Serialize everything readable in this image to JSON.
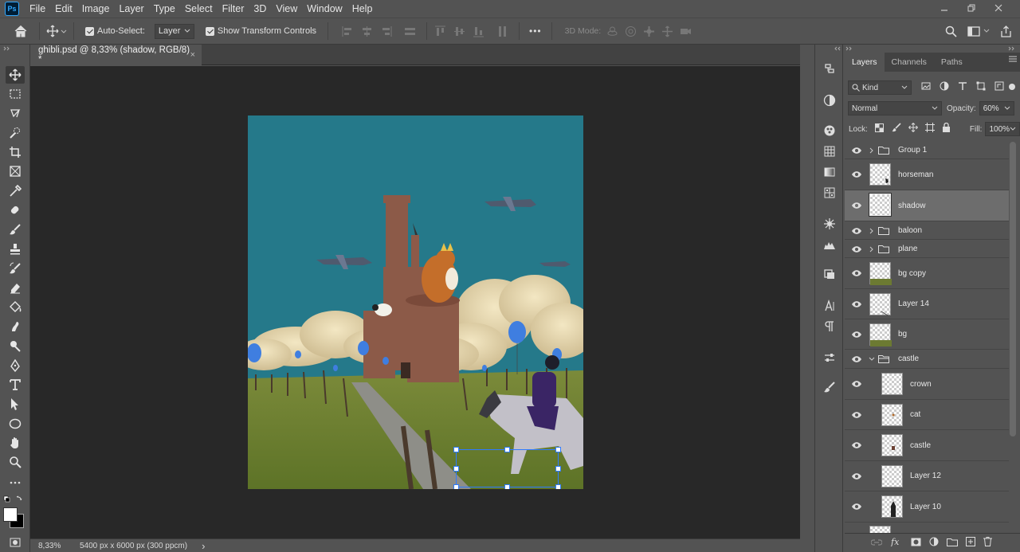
{
  "app": {
    "logo": "Ps"
  },
  "menu": [
    "File",
    "Edit",
    "Image",
    "Layer",
    "Type",
    "Select",
    "Filter",
    "3D",
    "View",
    "Window",
    "Help"
  ],
  "options_bar": {
    "auto_select_label": "Auto-Select:",
    "auto_select_checked": true,
    "auto_select_target": "Layer",
    "transform_controls_label": "Show Transform Controls",
    "transform_controls_checked": true,
    "more_label": "•••",
    "mode_3d_label": "3D Mode:"
  },
  "document_tab": {
    "title": "ghibli.psd @ 8,33% (shadow, RGB/8) *",
    "close": "×"
  },
  "status": {
    "zoom": "8,33%",
    "doc_info": "5400 px x 6000 px (300 ppcm)",
    "arrow": "›"
  },
  "panel": {
    "tabs": [
      "Layers",
      "Channels",
      "Paths"
    ],
    "active_tab": "Layers",
    "filter_kind": "Kind",
    "blend_mode": "Normal",
    "opacity_label": "Opacity:",
    "opacity_value": "60%",
    "lock_label": "Lock:",
    "fill_label": "Fill:",
    "fill_value": "100%"
  },
  "layers": [
    {
      "name": "Group 1",
      "type": "group",
      "expanded": false,
      "indent": 0,
      "selected": false
    },
    {
      "name": "horseman",
      "type": "layer",
      "indent": 0,
      "selected": false
    },
    {
      "name": "shadow",
      "type": "layer",
      "indent": 0,
      "selected": true
    },
    {
      "name": "baloon",
      "type": "group",
      "expanded": false,
      "indent": 0,
      "selected": false
    },
    {
      "name": "plane",
      "type": "group",
      "expanded": false,
      "indent": 0,
      "selected": false
    },
    {
      "name": "bg copy",
      "type": "layer",
      "indent": 0,
      "selected": false
    },
    {
      "name": "Layer 14",
      "type": "layer",
      "indent": 0,
      "selected": false
    },
    {
      "name": "bg",
      "type": "layer",
      "indent": 0,
      "selected": false
    },
    {
      "name": "castle",
      "type": "group",
      "expanded": true,
      "indent": 0,
      "selected": false
    },
    {
      "name": "crown",
      "type": "layer",
      "indent": 1,
      "selected": false
    },
    {
      "name": "cat",
      "type": "layer",
      "indent": 1,
      "selected": false
    },
    {
      "name": "castle",
      "type": "layer",
      "indent": 1,
      "selected": false
    },
    {
      "name": "Layer 12",
      "type": "layer",
      "indent": 1,
      "selected": false
    },
    {
      "name": "Layer 10",
      "type": "layer",
      "indent": 1,
      "selected": false
    }
  ],
  "colors": {
    "ui_bg": "#535353",
    "canvas_bg": "#282828",
    "sky": "#25798a",
    "selected_layer": "#6d6d6d",
    "accent": "#31a8ff"
  }
}
